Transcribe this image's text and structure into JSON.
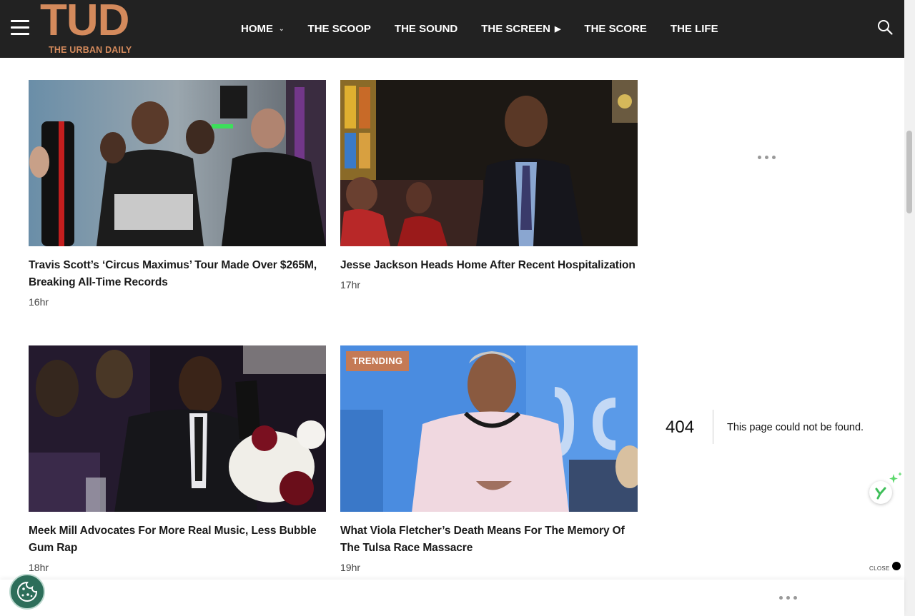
{
  "header": {
    "logo_mark": "TUD",
    "logo_text": "THE URBAN DAILY",
    "nav": [
      {
        "label": "HOME",
        "icon": "chevron-down-icon"
      },
      {
        "label": "THE SCOOP"
      },
      {
        "label": "THE SOUND"
      },
      {
        "label": "THE SCREEN",
        "icon": "play-icon"
      },
      {
        "label": "THE SCORE"
      },
      {
        "label": "THE LIFE"
      }
    ],
    "menu_icon": "hamburger-menu-icon",
    "search_icon": "search-icon"
  },
  "articles": [
    {
      "title": "Travis Scott’s ‘Circus Maximus’ Tour Made Over $265M, Breaking All-Time Records",
      "time": "16hr",
      "badge": ""
    },
    {
      "title": "Jesse Jackson Heads Home After Recent Hospitalization",
      "time": "17hr",
      "badge": ""
    },
    {
      "title": "Meek Mill Advocates For More Real Music, Less Bubble Gum Rap",
      "time": "18hr",
      "badge": ""
    },
    {
      "title": "What Viola Fletcher’s Death Means For The Memory Of The Tulsa Race Massacre",
      "time": "19hr",
      "badge": "TRENDING"
    }
  ],
  "sidebar": {
    "error_code": "404",
    "error_message": "This page could not be found."
  },
  "adbar": {
    "close_label": "CLOSE"
  },
  "colors": {
    "header_bg": "#222222",
    "brand_accent": "#d48a5c",
    "badge_bg": "#c47a55",
    "cookie_button": "#2d6e5a"
  }
}
